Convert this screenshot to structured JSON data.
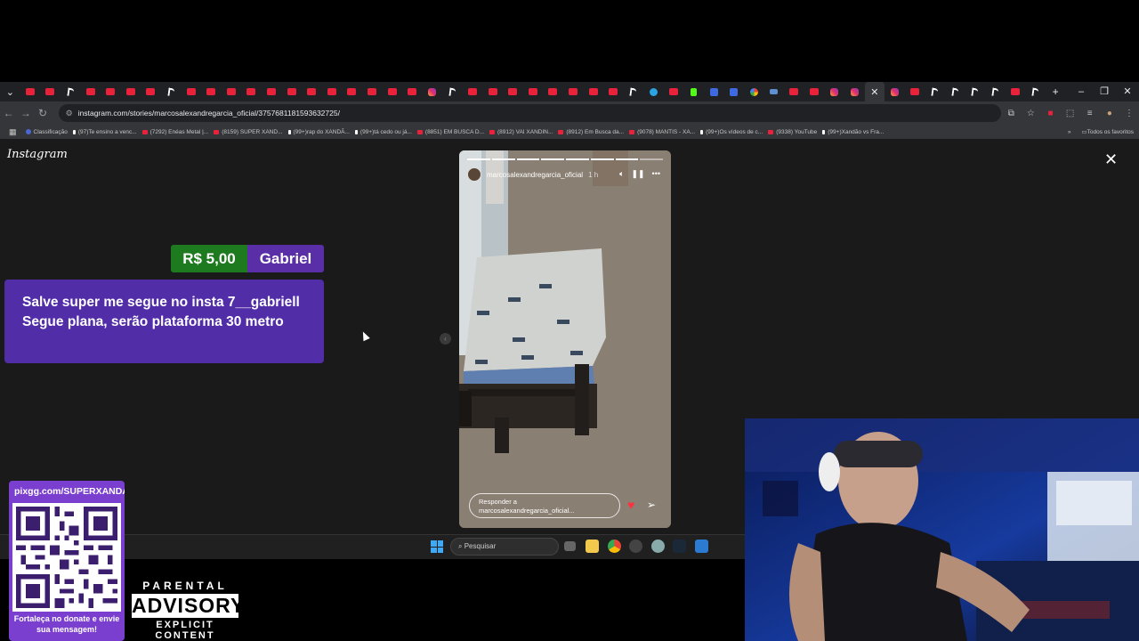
{
  "browser": {
    "tabs": [
      "yt",
      "yt",
      "tk",
      "yt",
      "yt",
      "yt",
      "yt",
      "tk",
      "yt",
      "yt",
      "yt",
      "yt",
      "yt",
      "yt",
      "yt",
      "yt",
      "yt",
      "yt",
      "yt",
      "yt",
      "ig",
      "tk",
      "yt",
      "yt",
      "yt",
      "yt",
      "yt",
      "yt",
      "yt",
      "yt",
      "tk",
      "tg",
      "yt",
      "kk",
      "gd",
      "gd",
      "gg",
      "bl",
      "yt",
      "yt",
      "ig",
      "ig",
      "cl",
      "ig",
      "yt",
      "tk",
      "tk",
      "tk",
      "tk",
      "yt",
      "tk"
    ],
    "active_tab_index": 42,
    "new_tab": "+",
    "url": "instagram.com/stories/marcosalexandregarcia_oficial/3757681181593632725/",
    "bookmarks": [
      {
        "label": "Classificação",
        "kind": "cl"
      },
      {
        "label": "(97)Te ensino a venc...",
        "kind": "tk"
      },
      {
        "label": "(7292) Enéas Metal |...",
        "kind": "yt"
      },
      {
        "label": "(8159) SUPER XAND...",
        "kind": "yt"
      },
      {
        "label": "(99+)rap do XANDÃ...",
        "kind": "tk"
      },
      {
        "label": "(99+)tá cedo ou já...",
        "kind": "tk"
      },
      {
        "label": "(8851) EM BUSCA D...",
        "kind": "yt"
      },
      {
        "label": "(8912) VAI XANDIN...",
        "kind": "yt"
      },
      {
        "label": "(8912) Em Busca da...",
        "kind": "yt"
      },
      {
        "label": "(9078) MANTIS - XA...",
        "kind": "yt"
      },
      {
        "label": "(99+)Os vídeos de c...",
        "kind": "tk"
      },
      {
        "label": "(9338) YouTube",
        "kind": "yt"
      },
      {
        "label": "(99+)Xandão vs Fra...",
        "kind": "tk"
      }
    ],
    "bookmarks_more": "»",
    "all_bookmarks": "Todos os favoritos"
  },
  "instagram": {
    "logo": "Instagram",
    "story": {
      "username": "marcosalexandregarcia_oficial",
      "time": "1 h",
      "progress_segments": 8,
      "progress_done": 7,
      "reply_placeholder": "Responder a marcosalexandregarcia_oficial..."
    }
  },
  "donation": {
    "amount": "R$ 5,00",
    "name": "Gabriel",
    "message": "Salve super me segue no insta 7__gabriell Segue plana, serão plataforma 30 metro"
  },
  "taskbar": {
    "search_placeholder": "Pesquisar"
  },
  "overlay": {
    "pix_url": "pixgg.com/SUPERXANDAO",
    "pix_cta": "Fortaleça no donate e envie sua mensagem!",
    "advisory_top": "PARENTAL",
    "advisory_mid": "ADVISORY",
    "advisory_bot": "EXPLICIT CONTENT"
  },
  "colors": {
    "donation_amount_bg": "#1d7a1f",
    "donation_name_bg": "#5a2ea6",
    "donation_message_bg": "#512da8",
    "pix_bg": "#7b3fd0"
  }
}
